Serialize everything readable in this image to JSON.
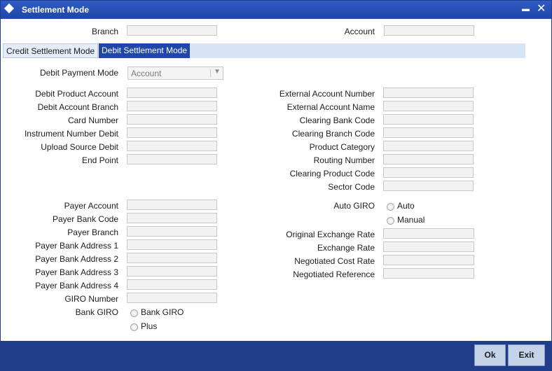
{
  "window": {
    "title": "Settlement Mode",
    "minimize_glyph": "▬",
    "close_glyph": "✕"
  },
  "header": {
    "branch_label": "Branch",
    "branch_value": "",
    "account_label": "Account",
    "account_value": ""
  },
  "tabs": [
    {
      "label": "Credit Settlement Mode",
      "active": false
    },
    {
      "label": "Debit Settlement Mode",
      "active": true
    }
  ],
  "debit_payment_mode": {
    "label": "Debit Payment Mode",
    "value": "Account"
  },
  "left_group1": [
    {
      "label": "Debit Product Account",
      "value": ""
    },
    {
      "label": "Debit Account Branch",
      "value": ""
    },
    {
      "label": "Card Number",
      "value": ""
    },
    {
      "label": "Instrument Number Debit",
      "value": ""
    },
    {
      "label": "Upload Source Debit",
      "value": ""
    },
    {
      "label": "End Point",
      "value": ""
    }
  ],
  "right_group1": [
    {
      "label": "External Account Number",
      "value": ""
    },
    {
      "label": "External Account Name",
      "value": ""
    },
    {
      "label": "Clearing Bank Code",
      "value": ""
    },
    {
      "label": "Clearing Branch Code",
      "value": ""
    },
    {
      "label": "Product Category",
      "value": ""
    },
    {
      "label": "Routing Number",
      "value": ""
    },
    {
      "label": "Clearing Product Code",
      "value": ""
    },
    {
      "label": "Sector Code",
      "value": ""
    }
  ],
  "left_group2": [
    {
      "label": "Payer Account",
      "value": ""
    },
    {
      "label": "Payer Bank Code",
      "value": ""
    },
    {
      "label": "Payer Branch",
      "value": ""
    },
    {
      "label": "Payer Bank Address 1",
      "value": ""
    },
    {
      "label": "Payer Bank Address 2",
      "value": ""
    },
    {
      "label": "Payer Bank Address 3",
      "value": ""
    },
    {
      "label": "Payer Bank Address 4",
      "value": ""
    },
    {
      "label": "GIRO Number",
      "value": ""
    }
  ],
  "bank_giro": {
    "label": "Bank GIRO",
    "options": [
      "Bank GIRO",
      "Plus"
    ]
  },
  "auto_giro": {
    "label": "Auto GIRO",
    "options": [
      "Auto",
      "Manual"
    ]
  },
  "right_group2": [
    {
      "label": "Original Exchange Rate",
      "value": ""
    },
    {
      "label": "Exchange Rate",
      "value": ""
    },
    {
      "label": "Negotiated Cost Rate",
      "value": ""
    },
    {
      "label": "Negotiated Reference",
      "value": ""
    }
  ],
  "footer": {
    "ok_label": "Ok",
    "exit_label": "Exit"
  }
}
